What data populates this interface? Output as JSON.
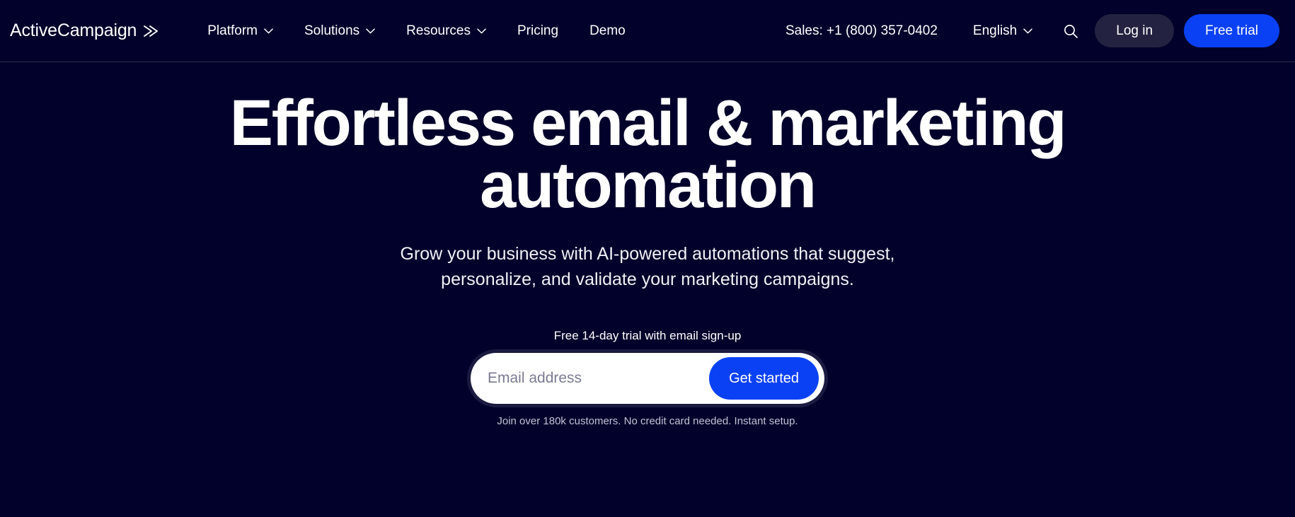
{
  "brand": {
    "name": "ActiveCampaign",
    "mark_icon": "double-chevron-right-icon"
  },
  "nav": {
    "primary": [
      {
        "label": "Platform",
        "has_dropdown": true,
        "icon": "chevron-down-icon"
      },
      {
        "label": "Solutions",
        "has_dropdown": true,
        "icon": "chevron-down-icon"
      },
      {
        "label": "Resources",
        "has_dropdown": true,
        "icon": "chevron-down-icon"
      },
      {
        "label": "Pricing",
        "has_dropdown": false
      },
      {
        "label": "Demo",
        "has_dropdown": false
      }
    ],
    "sales_phone": "Sales: +1 (800) 357-0402",
    "language": "English",
    "language_icon": "chevron-down-icon",
    "search_icon": "search-icon",
    "login_label": "Log in",
    "trial_label": "Free trial"
  },
  "hero": {
    "title": "Effortless email & marketing automation",
    "subtitle": "Grow your business with AI-powered automations that suggest, personalize, and validate your marketing campaigns."
  },
  "form": {
    "label": "Free 14-day trial with email sign-up",
    "email_placeholder": "Email address",
    "email_value": "",
    "submit_label": "Get started",
    "fineprint": "Join over 180k customers. No credit card needed. Instant setup."
  },
  "colors": {
    "background": "#02012b",
    "accent_blue": "#0b41f5",
    "login_pill": "#232240",
    "text_primary": "#ffffff",
    "text_muted": "#c2c2d4",
    "divider": "#2b2b4a"
  }
}
